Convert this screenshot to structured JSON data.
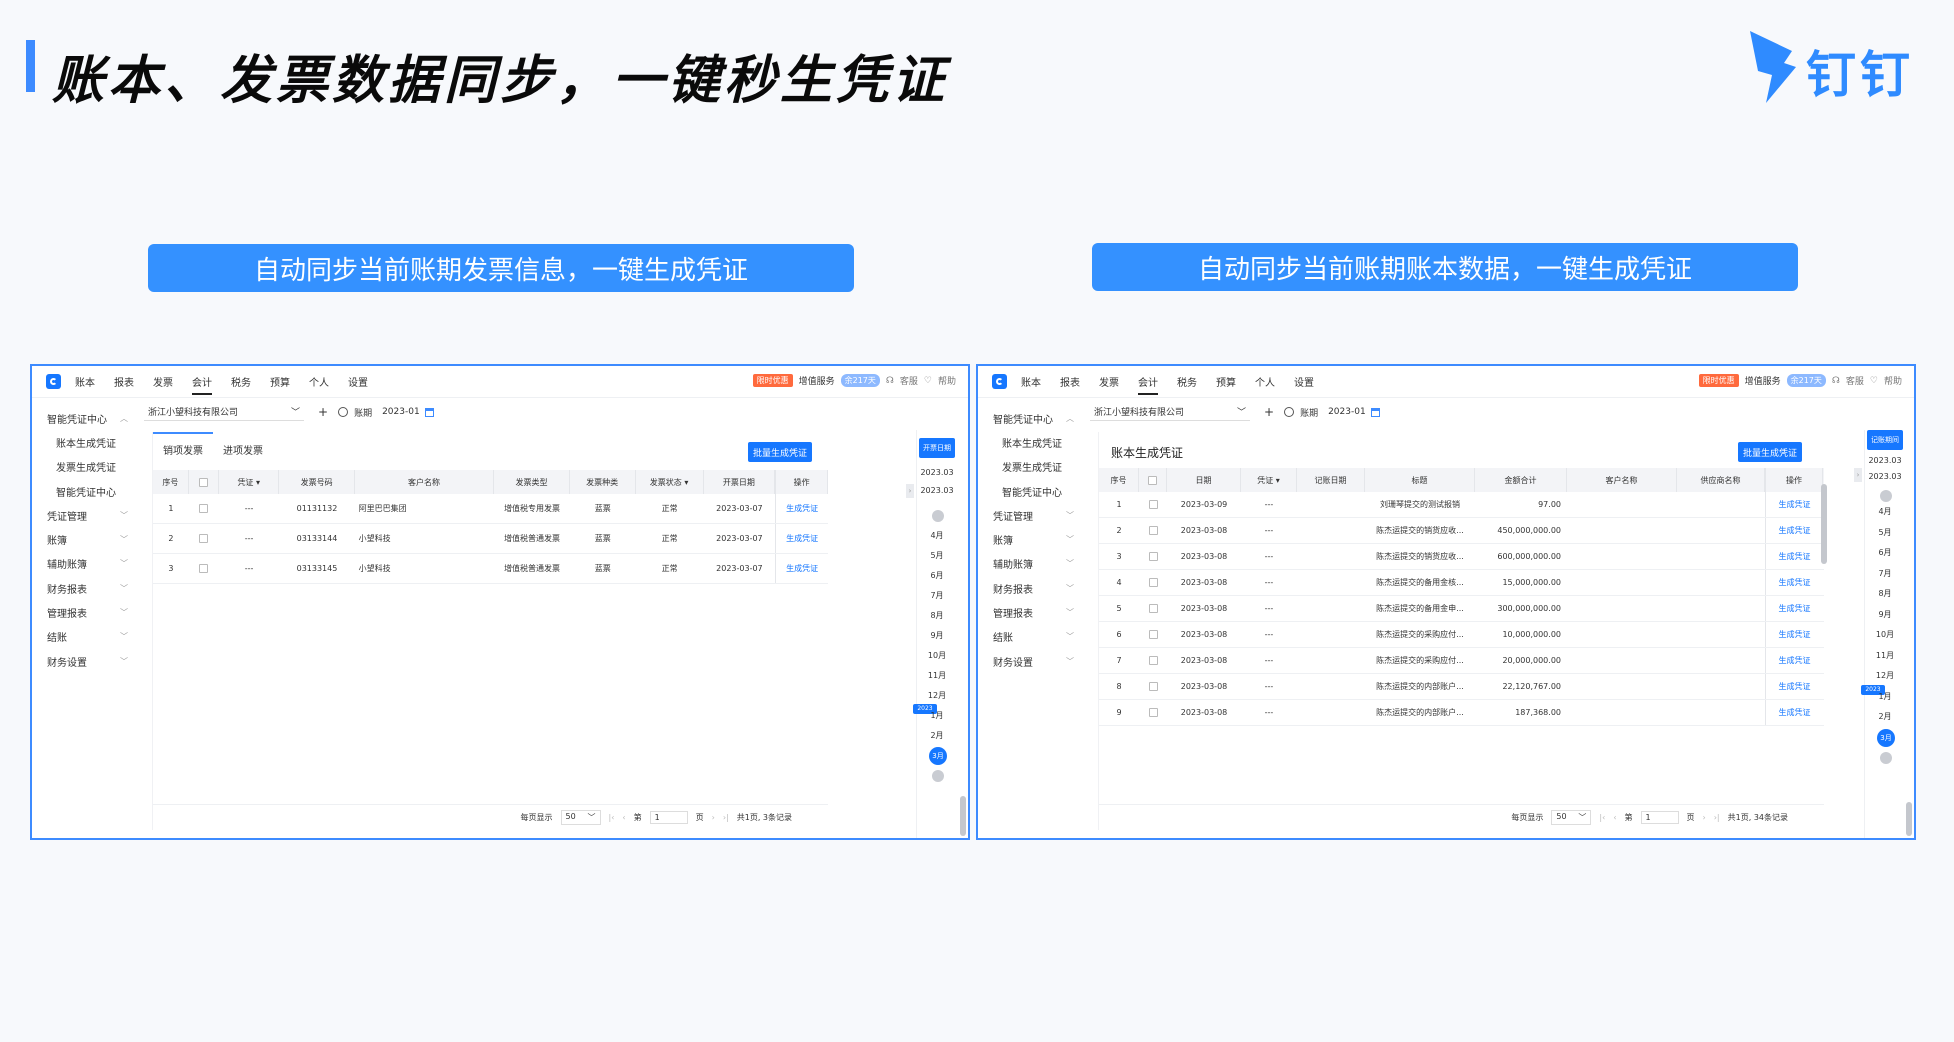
{
  "title": "账本、发票数据同步，一键秒生凭证",
  "logo_text": "钉钉",
  "banners": {
    "left": "自动同步当前账期发票信息，一键生成凭证",
    "right": "自动同步当前账期账本数据，一键生成凭证"
  },
  "app": {
    "nav": [
      "账本",
      "报表",
      "发票",
      "会计",
      "税务",
      "预算",
      "个人",
      "设置"
    ],
    "promo": "限时优惠",
    "service": "增值服务",
    "remaining": "余217天",
    "support": "客服",
    "help": "帮助",
    "sidebar": {
      "center": "智能凭证中心",
      "sub": [
        "账本生成凭证",
        "发票生成凭证",
        "智能凭证中心"
      ],
      "groups": [
        "凭证管理",
        "账簿",
        "辅助账簿",
        "财务报表",
        "管理报表",
        "结账",
        "财务设置"
      ]
    },
    "company": "浙江小望科技有限公司",
    "period_label": "账期",
    "period_value": "2023-01"
  },
  "left_panel": {
    "tabs": [
      "销项发票",
      "进项发票"
    ],
    "batch_button": "批量生成凭证",
    "strip_button": "开票日期",
    "columns": [
      "序号",
      "凭证",
      "发票号码",
      "客户名称",
      "发票类型",
      "发票种类",
      "发票状态",
      "开票日期",
      "操作"
    ],
    "rows": [
      {
        "no": "1",
        "voucher": "---",
        "invoice_no": "01131132",
        "customer": "阿里巴巴集团",
        "type": "增值税专用发票",
        "kind": "蓝票",
        "status": "正常",
        "date": "2023-03-07",
        "op": "生成凭证"
      },
      {
        "no": "2",
        "voucher": "---",
        "invoice_no": "03133144",
        "customer": "小望科技",
        "type": "增值税普通发票",
        "kind": "蓝票",
        "status": "正常",
        "date": "2023-03-07",
        "op": "生成凭证"
      },
      {
        "no": "3",
        "voucher": "---",
        "invoice_no": "03133145",
        "customer": "小望科技",
        "type": "增值税普通发票",
        "kind": "蓝票",
        "status": "正常",
        "date": "2023-03-07",
        "op": "生成凭证"
      }
    ],
    "footer": {
      "per_page_label": "每页显示",
      "per_page": "50",
      "page_prefix": "第",
      "page": "1",
      "page_suffix": "页",
      "summary": "共1页, 3条记录"
    }
  },
  "right_panel": {
    "heading": "账本生成凭证",
    "batch_button": "批量生成凭证",
    "strip_button": "记账期间",
    "columns": [
      "序号",
      "日期",
      "凭证",
      "记账日期",
      "标题",
      "金额合计",
      "客户名称",
      "供应商名称",
      "操作"
    ],
    "rows": [
      {
        "no": "1",
        "date": "2023-03-09",
        "voucher": "---",
        "title": "刘珊琴提交的测试报销",
        "amount": "97.00",
        "op": "生成凭证"
      },
      {
        "no": "2",
        "date": "2023-03-08",
        "voucher": "---",
        "title": "陈杰运提交的销货应收...",
        "amount": "450,000,000.00",
        "op": "生成凭证"
      },
      {
        "no": "3",
        "date": "2023-03-08",
        "voucher": "---",
        "title": "陈杰运提交的销货应收...",
        "amount": "600,000,000.00",
        "op": "生成凭证"
      },
      {
        "no": "4",
        "date": "2023-03-08",
        "voucher": "---",
        "title": "陈杰运提交的备用金核...",
        "amount": "15,000,000.00",
        "op": "生成凭证"
      },
      {
        "no": "5",
        "date": "2023-03-08",
        "voucher": "---",
        "title": "陈杰运提交的备用金申...",
        "amount": "300,000,000.00",
        "op": "生成凭证"
      },
      {
        "no": "6",
        "date": "2023-03-08",
        "voucher": "---",
        "title": "陈杰运提交的采购应付...",
        "amount": "10,000,000.00",
        "op": "生成凭证"
      },
      {
        "no": "7",
        "date": "2023-03-08",
        "voucher": "---",
        "title": "陈杰运提交的采购应付...",
        "amount": "20,000,000.00",
        "op": "生成凭证"
      },
      {
        "no": "8",
        "date": "2023-03-08",
        "voucher": "---",
        "title": "陈杰运提交的内部账户...",
        "amount": "22,120,767.00",
        "op": "生成凭证"
      },
      {
        "no": "9",
        "date": "2023-03-08",
        "voucher": "---",
        "title": "陈杰运提交的内部账户...",
        "amount": "187,368.00",
        "op": "生成凭证"
      }
    ],
    "footer": {
      "per_page_label": "每页显示",
      "per_page": "50",
      "page_prefix": "第",
      "page": "1",
      "page_suffix": "页",
      "summary": "共1页, 34条记录"
    }
  },
  "strip": {
    "years": [
      "2023.03",
      "2023.03"
    ],
    "months_2022": [
      "4月",
      "5月",
      "6月",
      "7月",
      "8月",
      "9月",
      "10月",
      "11月",
      "12月"
    ],
    "year_tag": "2023",
    "months_2023": [
      "1月",
      "2月"
    ],
    "selected": "3月"
  },
  "colors": {
    "accent": "#3d8bff",
    "primary_button": "#1677ff",
    "promo": "#ff6a3d"
  },
  "icons": [
    "dingtalk-logo-icon",
    "app-logo-icon",
    "headset-icon",
    "help-icon",
    "chevron-down-icon",
    "plus-icon",
    "gear-icon",
    "calendar-icon"
  ]
}
